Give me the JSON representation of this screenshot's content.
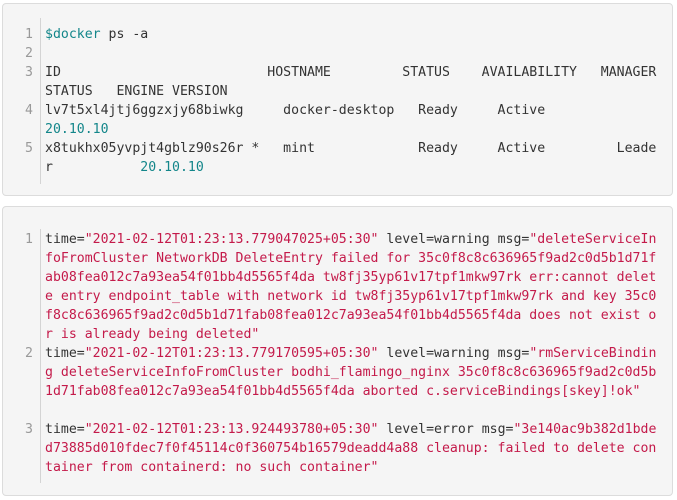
{
  "docker_block": {
    "lines": [
      {
        "num": "1",
        "prompt": "$docker",
        "text": " ps -a"
      },
      {
        "num": "2",
        "text": ""
      },
      {
        "num": "3",
        "text": "ID                          HOSTNAME         STATUS    AVAILABILITY   MANAGER STATUS   ENGINE VERSION"
      },
      {
        "num": "4",
        "text": "lv7t5xl4jtj6ggzxjy68biwkg     docker-desktop   Ready     Active",
        "version": "20.10.10"
      },
      {
        "num": "5",
        "text": "x8tukhx05yvpjt4gblz90s26r *   mint             Ready     Active         Leader",
        "version": "20.10.10"
      }
    ]
  },
  "log_block": {
    "lines": [
      {
        "num": "1",
        "time_key": "time=",
        "time_val": "\"2021-02-12T01:23:13.779047025+05:30\"",
        "level_key": "level=warning",
        "msg_key": "msg=",
        "msg_val": "\"deleteServiceInfoFromCluster NetworkDB DeleteEntry failed for 35c0f8c8c636965f9ad2c0d5b1d71fab08fea012c7a93ea54f01bb4d5565f4da tw8fj35yp61v17tpf1mkw97rk err:cannot delete entry endpoint_table with network id tw8fj35yp61v17tpf1mkw97rk and key 35c0f8c8c636965f9ad2c0d5b1d71fab08fea012c7a93ea54f01bb4d5565f4da does not exist or is already being deleted\""
      },
      {
        "num": "2",
        "time_key": "time=",
        "time_val": "\"2021-02-12T01:23:13.779170595+05:30\"",
        "level_key": "level=warning",
        "msg_key": "msg=",
        "msg_val": "\"rmServiceBinding deleteServiceInfoFromCluster bodhi_flamingo_nginx 35c0f8c8c636965f9ad2c0d5b1d71fab08fea012c7a93ea54f01bb4d5565f4da aborted c.serviceBindings[skey]!ok\""
      },
      {
        "num": "3",
        "time_key": "time=",
        "time_val": "\"2021-02-12T01:23:13.924493780+05:30\"",
        "level_key": "level=error",
        "msg_key": "msg=",
        "msg_val": "\"3e140ac9b382d1bded73885d010fdec7f0f45114c0f360754b16579deadd4a88 cleanup: failed to delete container from containerd: no such container\""
      }
    ]
  }
}
